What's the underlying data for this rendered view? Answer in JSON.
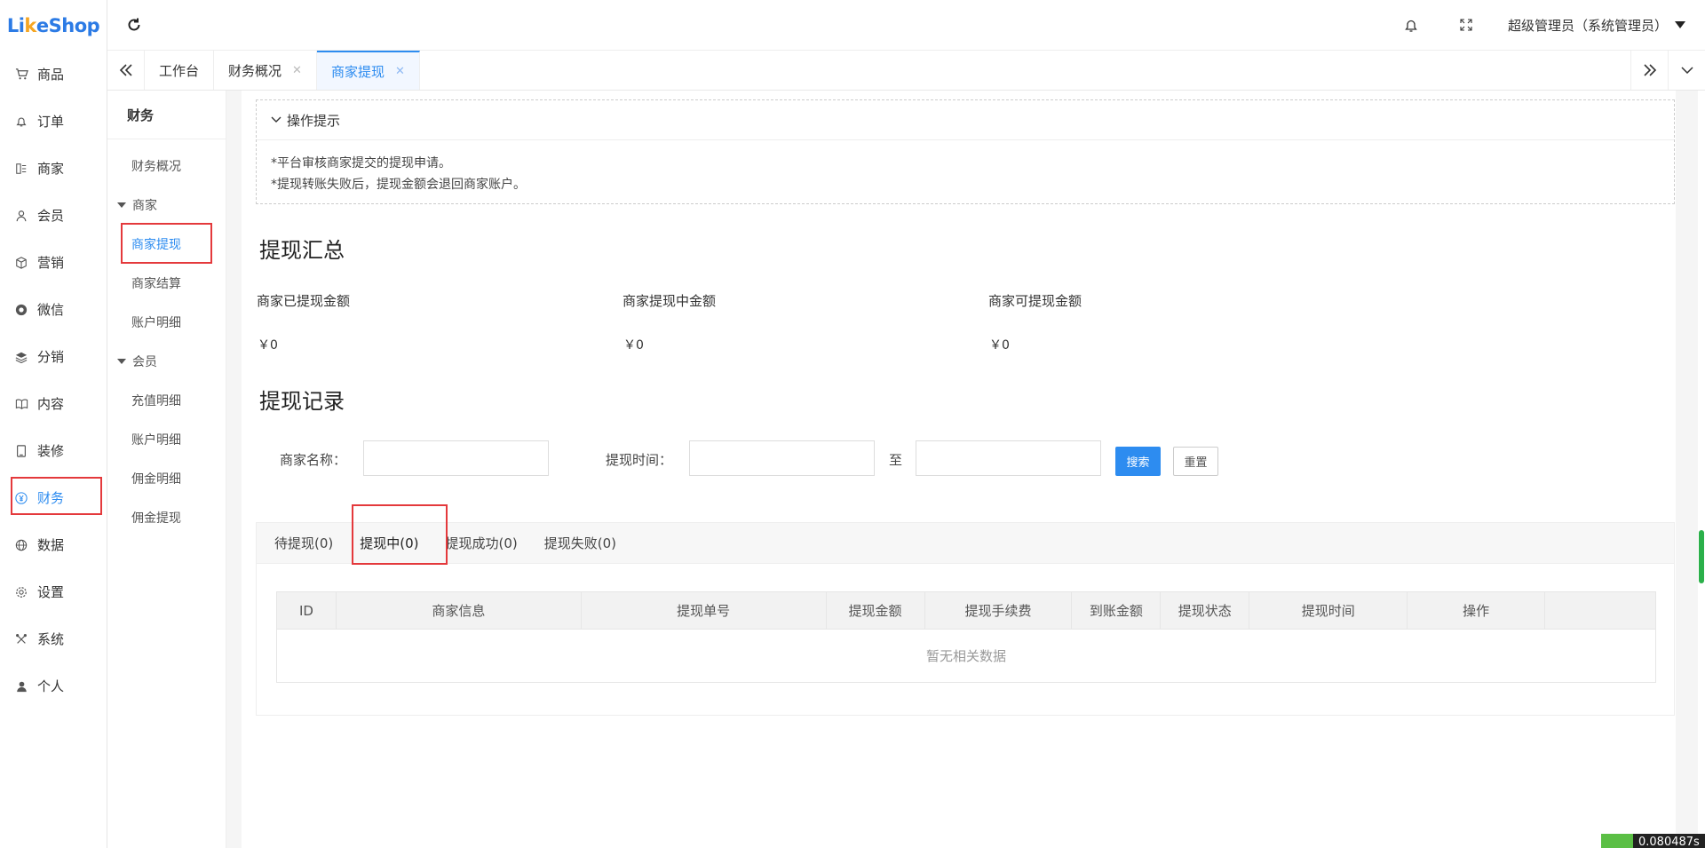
{
  "app": {
    "logo": "LikeShop",
    "logo_part1": "Li",
    "logo_part2": "k",
    "logo_part3": "eShop"
  },
  "colors": {
    "accent": "#2d8cf0",
    "highlight_frame": "#e4393c",
    "logo": "#2c7be5"
  },
  "sidebar": {
    "items": [
      {
        "label": "商品",
        "icon": "cart-icon"
      },
      {
        "label": "订单",
        "icon": "bell-icon"
      },
      {
        "label": "商家",
        "icon": "store-icon"
      },
      {
        "label": "会员",
        "icon": "user-icon"
      },
      {
        "label": "营销",
        "icon": "box-icon"
      },
      {
        "label": "微信",
        "icon": "wechat-icon"
      },
      {
        "label": "分销",
        "icon": "layers-icon"
      },
      {
        "label": "内容",
        "icon": "book-icon"
      },
      {
        "label": "装修",
        "icon": "tablet-icon"
      },
      {
        "label": "财务",
        "icon": "yen-icon"
      },
      {
        "label": "数据",
        "icon": "globe-icon"
      },
      {
        "label": "设置",
        "icon": "gear-icon"
      },
      {
        "label": "系统",
        "icon": "tools-icon"
      },
      {
        "label": "个人",
        "icon": "person-icon"
      }
    ]
  },
  "topbar": {
    "user": "超级管理员（系统管理员）"
  },
  "tabs": [
    {
      "label": "工作台"
    },
    {
      "label": "财务概况"
    },
    {
      "label": "商家提现"
    }
  ],
  "subnav": {
    "title": "财务",
    "overview": "财务概况",
    "group1": "商家",
    "g1_items": [
      "商家提现",
      "商家结算",
      "账户明细"
    ],
    "group2": "会员",
    "g2_items": [
      "充值明细",
      "账户明细",
      "佣金明细",
      "佣金提现"
    ]
  },
  "tips": {
    "title": "操作提示",
    "lines": [
      "*平台审核商家提交的提现申请。",
      "*提现转账失败后，提现金额会退回商家账户。"
    ]
  },
  "summary": {
    "title": "提现汇总",
    "items": [
      {
        "label": "商家已提现金额",
        "value": "￥0"
      },
      {
        "label": "商家提现中金额",
        "value": "￥0"
      },
      {
        "label": "商家可提现金额",
        "value": "￥0"
      }
    ]
  },
  "records": {
    "title": "提现记录",
    "merchant_label": "商家名称：",
    "time_label": "提现时间：",
    "to": "至",
    "search": "搜索",
    "reset": "重置",
    "tabs": [
      "待提现(0)",
      "提现中(0)",
      "提现成功(0)",
      "提现失败(0)"
    ],
    "columns": [
      "ID",
      "商家信息",
      "提现单号",
      "提现金额",
      "提现手续费",
      "到账金额",
      "提现状态",
      "提现时间",
      "操作",
      ""
    ],
    "empty": "暂无相关数据"
  },
  "widget": {
    "text": "0.080487s"
  }
}
